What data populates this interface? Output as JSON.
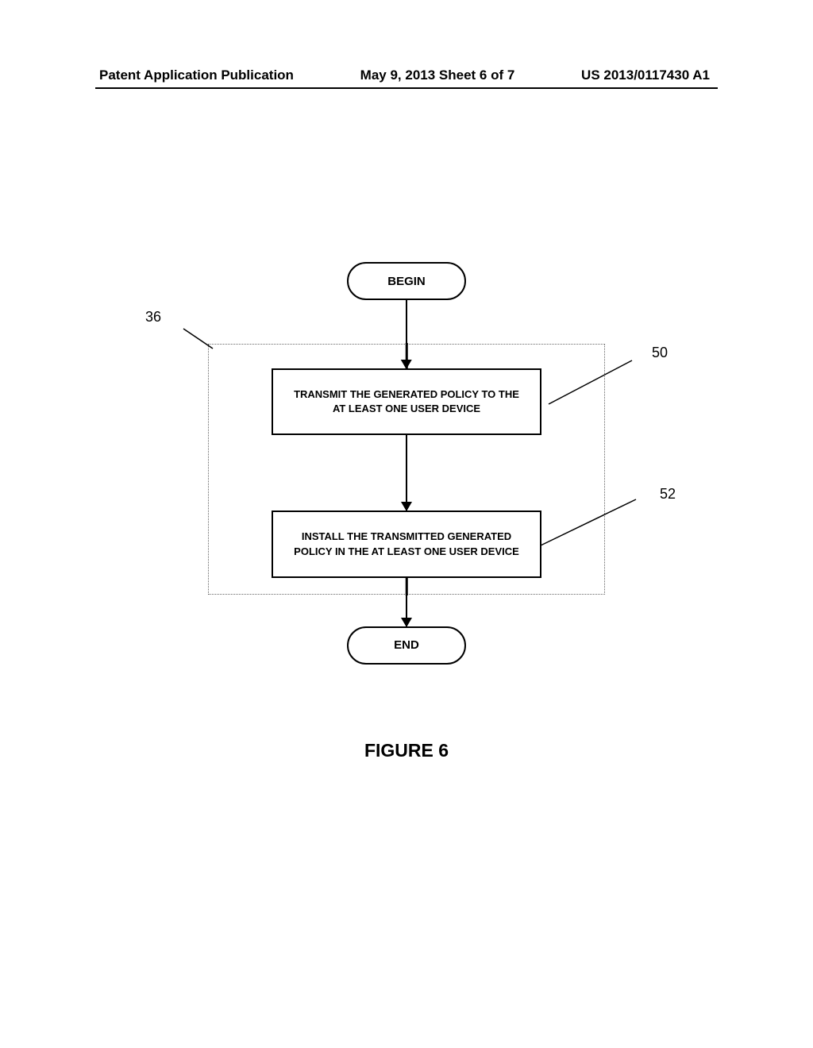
{
  "header": {
    "left": "Patent Application Publication",
    "center": "May 9, 2013  Sheet 6 of 7",
    "right": "US 2013/0117430 A1"
  },
  "flowchart": {
    "begin": "BEGIN",
    "step50": "TRANSMIT THE GENERATED POLICY TO THE AT LEAST ONE USER DEVICE",
    "step52": "INSTALL THE TRANSMITTED GENERATED POLICY IN THE AT LEAST ONE USER DEVICE",
    "end": "END"
  },
  "labels": {
    "ref36": "36",
    "ref50": "50",
    "ref52": "52"
  },
  "caption": "FIGURE 6"
}
